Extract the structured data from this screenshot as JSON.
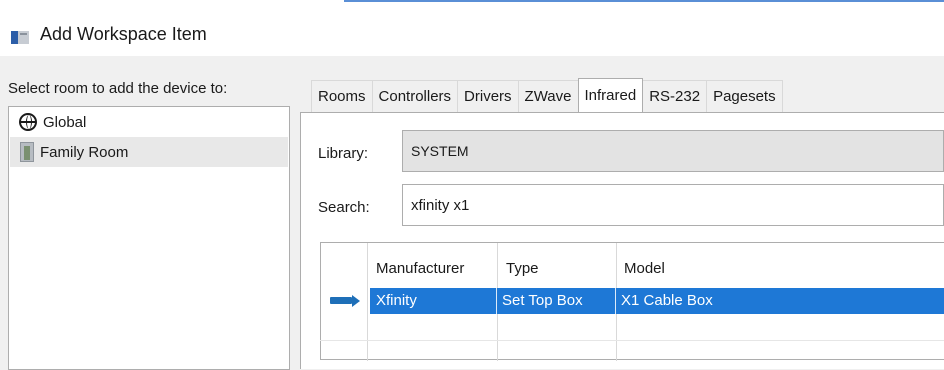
{
  "window": {
    "title": "Add Workspace Item"
  },
  "rooms": {
    "label": "Select room to add the device to:",
    "items": [
      {
        "label": "Global",
        "icon": "globe-icon"
      },
      {
        "label": "Family Room",
        "icon": "room-icon",
        "selected": true
      }
    ]
  },
  "tabs": [
    {
      "label": "Rooms"
    },
    {
      "label": "Controllers"
    },
    {
      "label": "Drivers"
    },
    {
      "label": "ZWave"
    },
    {
      "label": "Infrared",
      "active": true
    },
    {
      "label": "RS-232"
    },
    {
      "label": "Pagesets"
    }
  ],
  "form": {
    "library_label": "Library:",
    "library_value": "SYSTEM",
    "search_label": "Search:",
    "search_value": "xfinity x1"
  },
  "table": {
    "columns": [
      "Manufacturer",
      "Type",
      "Model"
    ],
    "rows": [
      {
        "manufacturer": "Xfinity",
        "type": "Set Top Box",
        "model": "X1 Cable Box",
        "selected": true
      }
    ]
  },
  "colors": {
    "selection": "#1e78d6",
    "accent": "#2c5ea8"
  }
}
